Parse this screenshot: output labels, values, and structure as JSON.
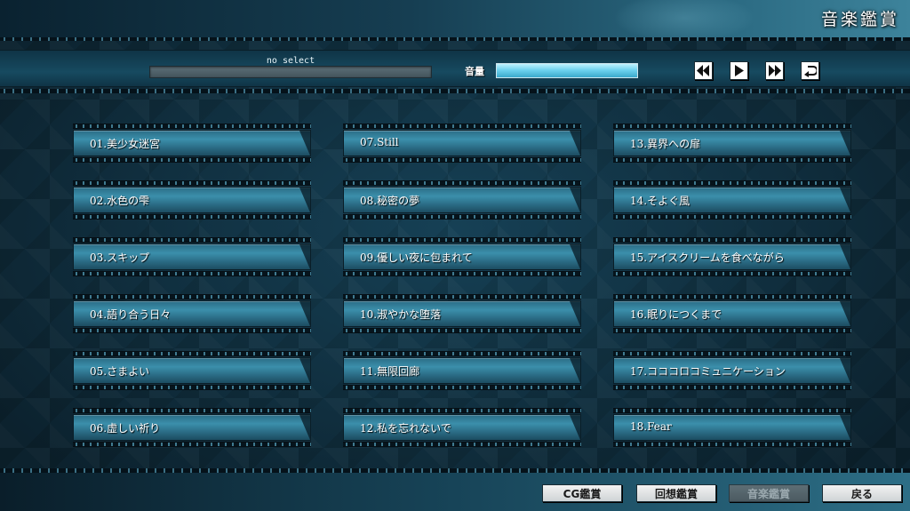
{
  "header": {
    "title": "音楽鑑賞"
  },
  "player": {
    "now_playing": "no select",
    "volume_label": "音量",
    "volume_level": 1.0,
    "controls": [
      "rewind-icon",
      "play-icon",
      "fast-forward-icon",
      "repeat-icon"
    ]
  },
  "tracks": [
    "01.美少女迷宮",
    "02.水色の雫",
    "03.スキップ",
    "04.語り合う日々",
    "05.さまよい",
    "06.虚しい祈り",
    "07.Still",
    "08.秘密の夢",
    "09.優しい夜に包まれて",
    "10.淑やかな堕落",
    "11.無限回廊",
    "12.私を忘れないで",
    "13.異界への扉",
    "14.そよぐ風",
    "15.アイスクリームを食べながら",
    "16.眠りにつくまで",
    "17.コココロコミュニケーション",
    "18.Fear"
  ],
  "footer": {
    "cg_button": "CG鑑賞",
    "recall_button": "回想鑑賞",
    "music_button": "音楽鑑賞",
    "back_button": "戻る"
  },
  "colors": {
    "accent": "#6fd3ef",
    "plate": "#3b8fab",
    "background": "#123447"
  }
}
